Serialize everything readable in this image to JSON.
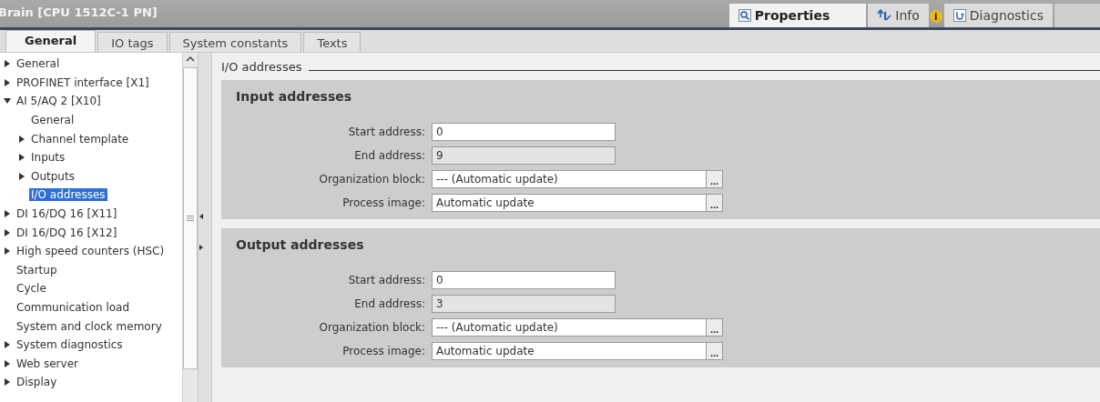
{
  "window": {
    "title": "Brain [CPU 1512C-1 PN]"
  },
  "inspector_tabs": [
    {
      "label": "Properties",
      "kind": "search",
      "selected": true
    },
    {
      "label": "Info",
      "kind": "info",
      "selected": false,
      "badge": "i"
    },
    {
      "label": "Diagnostics",
      "kind": "diagnostics",
      "selected": false
    }
  ],
  "tabs": [
    {
      "label": "General",
      "selected": true
    },
    {
      "label": "IO tags",
      "selected": false
    },
    {
      "label": "System constants",
      "selected": false
    },
    {
      "label": "Texts",
      "selected": false
    }
  ],
  "tree": [
    {
      "label": "General",
      "kind": "node",
      "expanded": false,
      "selected": false
    },
    {
      "label": "PROFINET interface [X1]",
      "kind": "node",
      "expanded": false,
      "selected": false
    },
    {
      "label": "AI 5/AQ 2 [X10]",
      "kind": "node",
      "expanded": true,
      "selected": false,
      "children": [
        {
          "label": "General",
          "kind": "leaf",
          "selected": false
        },
        {
          "label": "Channel template",
          "kind": "node",
          "expanded": false,
          "selected": false
        },
        {
          "label": "Inputs",
          "kind": "node",
          "expanded": false,
          "selected": false
        },
        {
          "label": "Outputs",
          "kind": "node",
          "expanded": false,
          "selected": false
        },
        {
          "label": "I/O addresses",
          "kind": "leaf",
          "selected": true
        }
      ]
    },
    {
      "label": "DI 16/DQ 16 [X11]",
      "kind": "node",
      "expanded": false,
      "selected": false
    },
    {
      "label": "DI 16/DQ 16 [X12]",
      "kind": "node",
      "expanded": false,
      "selected": false
    },
    {
      "label": "High speed counters (HSC)",
      "kind": "node",
      "expanded": false,
      "selected": false
    },
    {
      "label": "Startup",
      "kind": "leaf",
      "selected": false
    },
    {
      "label": "Cycle",
      "kind": "leaf",
      "selected": false
    },
    {
      "label": "Communication load",
      "kind": "leaf",
      "selected": false
    },
    {
      "label": "System and clock memory",
      "kind": "leaf",
      "selected": false
    },
    {
      "label": "System diagnostics",
      "kind": "node",
      "expanded": false,
      "selected": false
    },
    {
      "label": "Web server",
      "kind": "node",
      "expanded": false,
      "selected": false
    },
    {
      "label": "Display",
      "kind": "node",
      "expanded": false,
      "selected": false
    }
  ],
  "panel": {
    "title": "I/O addresses",
    "sections": [
      {
        "title": "Input addresses",
        "fields": [
          {
            "label": "Start address:",
            "kind": "input",
            "value": "0"
          },
          {
            "label": "End address:",
            "kind": "readonly",
            "value": "9"
          },
          {
            "label": "Organization block:",
            "kind": "select",
            "value": "--- (Automatic update)",
            "button": "..."
          },
          {
            "label": "Process image:",
            "kind": "select",
            "value": "Automatic update",
            "button": "..."
          }
        ]
      },
      {
        "title": "Output addresses",
        "fields": [
          {
            "label": "Start address:",
            "kind": "input",
            "value": "0"
          },
          {
            "label": "End address:",
            "kind": "readonly",
            "value": "3"
          },
          {
            "label": "Organization block:",
            "kind": "select",
            "value": "--- (Automatic update)",
            "button": "..."
          },
          {
            "label": "Process image:",
            "kind": "select",
            "value": "Automatic update",
            "button": "..."
          }
        ]
      }
    ]
  }
}
